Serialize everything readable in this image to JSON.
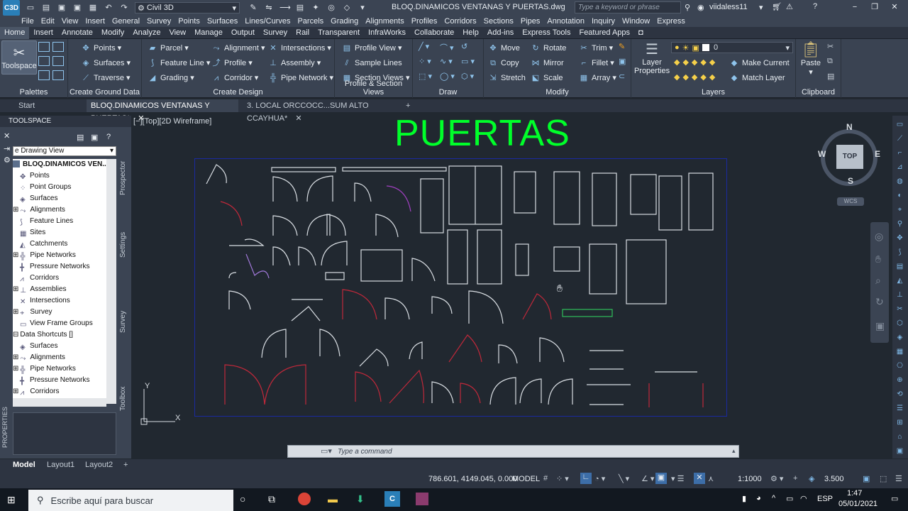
{
  "titlebar": {
    "logo": "C3D",
    "workspace": "Civil 3D",
    "document_title": "BLOQ.DINAMICOS VENTANAS Y PUERTAS.dwg",
    "search_placeholder": "Type a keyword or phrase",
    "user": "viidaless11"
  },
  "menubar": {
    "items": [
      "File",
      "Edit",
      "View",
      "Insert",
      "General",
      "Survey",
      "Points",
      "Surfaces",
      "Lines/Curves",
      "Parcels",
      "Grading",
      "Alignments",
      "Profiles",
      "Corridors",
      "Sections",
      "Pipes",
      "Annotation",
      "Inquiry",
      "Window",
      "Express"
    ]
  },
  "ribbon_tabs": [
    "Home",
    "Insert",
    "Annotate",
    "Modify",
    "Analyze",
    "View",
    "Manage",
    "Output",
    "Survey",
    "Rail",
    "Transparent",
    "InfraWorks",
    "Collaborate",
    "Help",
    "Add-ins",
    "Express Tools",
    "Featured Apps"
  ],
  "ribbon": {
    "palettes": {
      "toolspace": "Toolspace",
      "title": "Palettes"
    },
    "ground": {
      "points": "Points",
      "surfaces": "Surfaces",
      "traverse": "Traverse",
      "title": "Create Ground Data"
    },
    "design": {
      "parcel": "Parcel",
      "feature_line": "Feature Line",
      "grading": "Grading",
      "alignment": "Alignment",
      "profile": "Profile",
      "corridor": "Corridor",
      "intersections": "Intersections",
      "assembly": "Assembly",
      "pipe_network": "Pipe Network",
      "title": "Create Design"
    },
    "profile_section": {
      "profile_view": "Profile View",
      "sample_lines": "Sample Lines",
      "section_views": "Section Views",
      "title": "Profile & Section Views"
    },
    "draw": {
      "title": "Draw"
    },
    "modify": {
      "move": "Move",
      "rotate": "Rotate",
      "trim": "Trim",
      "copy": "Copy",
      "mirror": "Mirror",
      "fillet": "Fillet",
      "stretch": "Stretch",
      "scale": "Scale",
      "array": "Array",
      "title": "Modify"
    },
    "layers": {
      "layer_properties": "Layer Properties",
      "layer_value": "0",
      "make_current": "Make Current",
      "match_layer": "Match Layer",
      "title": "Layers"
    },
    "clipboard": {
      "paste": "Paste",
      "title": "Clipboard"
    }
  },
  "doc_tabs": [
    "Start",
    "BLOQ.DINAMICOS VENTANAS Y PUERTAS*",
    "3. LOCAL ORCCOCC...SUM ALTO CCAYHUA*"
  ],
  "toolspace": {
    "header": "TOOLSPACE",
    "view_select": "e Drawing View",
    "tree": [
      "BLOQ.DINAMICOS VEN...",
      "Points",
      "Point Groups",
      "Surfaces",
      "Alignments",
      "Feature Lines",
      "Sites",
      "Catchments",
      "Pipe Networks",
      "Pressure Networks",
      "Corridors",
      "Assemblies",
      "Intersections",
      "Survey",
      "View Frame Groups",
      "Data Shortcuts []",
      "Surfaces",
      "Alignments",
      "Pipe Networks",
      "Pressure Networks",
      "Corridors"
    ],
    "side_tabs": [
      "Prospector",
      "Settings",
      "Survey",
      "Toolbox"
    ],
    "properties": "PROPERTIES"
  },
  "drawing": {
    "viewport_label": "[−][Top][2D Wireframe]",
    "title": "PUERTAS",
    "title_color": "#00ff2a",
    "compass": {
      "n": "N",
      "s": "S",
      "e": "E",
      "w": "W",
      "top": "TOP",
      "wcs": "WCS"
    },
    "ucs_x": "X",
    "ucs_y": "Y"
  },
  "command_line": {
    "placeholder": "Type a command"
  },
  "layout_tabs": [
    "Model",
    "Layout1",
    "Layout2"
  ],
  "status": {
    "coords": "786.601, 4149.045, 0.000",
    "mode": "MODEL",
    "scale": "1:1000",
    "value": "3.500"
  },
  "taskbar": {
    "search": "Escribe aquí para buscar",
    "lang": "ESP",
    "time": "1:47",
    "date": "05/01/2021"
  }
}
